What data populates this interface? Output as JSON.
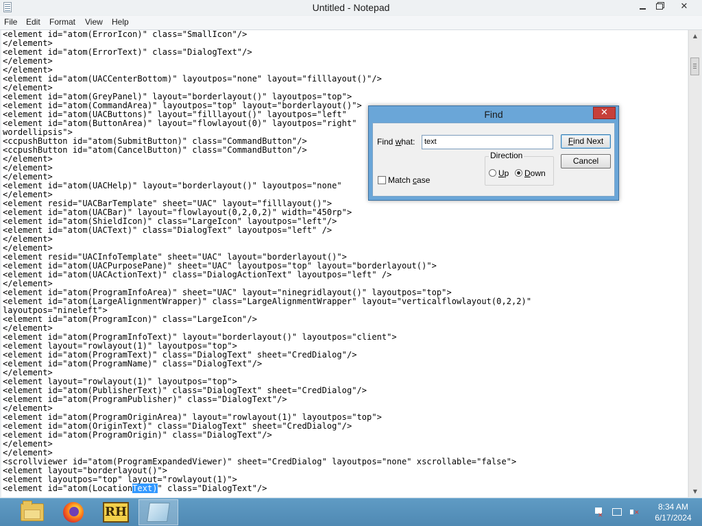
{
  "window": {
    "title": "Untitled - Notepad",
    "minimize_glyph": "",
    "close_glyph": "✕"
  },
  "menu": [
    "File",
    "Edit",
    "Format",
    "View",
    "Help"
  ],
  "editor": {
    "lines_before": [
      "<element id=\"atom(ErrorIcon)\" class=\"SmallIcon\"/>",
      "</element>",
      "<element id=\"atom(ErrorText)\" class=\"DialogText\"/>",
      "</element>",
      "</element>",
      "<element id=\"atom(UACCenterBottom)\" layoutpos=\"none\" layout=\"filllayout()\"/>",
      "</element>",
      "<element id=\"atom(GreyPanel)\" layout=\"borderlayout()\" layoutpos=\"top\">",
      "<element id=\"atom(CommandArea)\" layoutpos=\"top\" layout=\"borderlayout()\">",
      "<element id=\"atom(UACButtons)\" layout=\"filllayout()\" layoutpos=\"left\" ",
      "<element id=\"atom(ButtonArea)\" layout=\"flowlayout(0)\" layoutpos=\"right\" ",
      "wordellipsis\">",
      "<ccpushButton id=\"atom(SubmitButton)\" class=\"CommandButton\"/>",
      "<ccpushButton id=\"atom(CancelButton)\" class=\"CommandButton\"/>",
      "</element>",
      "</element>",
      "</element>",
      "<element id=\"atom(UACHelp)\" layout=\"borderlayout()\" layoutpos=\"none\"",
      "</element>",
      "<element resid=\"UACBarTemplate\" sheet=\"UAC\" layout=\"filllayout()\">",
      "<element id=\"atom(UACBar)\" layout=\"flowlayout(0,2,0,2)\" width=\"450rp\">",
      "<element id=\"atom(ShieldIcon)\" class=\"LargeIcon\" layoutpos=\"left\"/>",
      "<element id=\"atom(UACText)\" class=\"DialogText\" layoutpos=\"left\" />",
      "</element>",
      "</element>",
      "<element resid=\"UACInfoTemplate\" sheet=\"UAC\" layout=\"borderlayout()\">",
      "<element id=\"atom(UACPurposePane)\" sheet=\"UAC\" layoutpos=\"top\" layout=\"borderlayout()\">",
      "<element id=\"atom(UACActionText)\" class=\"DialogActionText\" layoutpos=\"left\" />",
      "</element>",
      "<element id=\"atom(ProgramInfoArea)\" sheet=\"UAC\" layout=\"ninegridlayout()\" layoutpos=\"top\">",
      "<element id=\"atom(LargeAlignmentWrapper)\" class=\"LargeAlignmentWrapper\" layout=\"verticalflowlayout(0,2,2)\"",
      "layoutpos=\"nineleft\">",
      "<element id=\"atom(ProgramIcon)\" class=\"LargeIcon\"/>",
      "</element>",
      "<element id=\"atom(ProgramInfoText)\" layout=\"borderlayout()\" layoutpos=\"client\">",
      "<element layout=\"rowlayout(1)\" layoutpos=\"top\">",
      "<element id=\"atom(ProgramText)\" class=\"DialogText\" sheet=\"CredDialog\"/>",
      "<element id=\"atom(ProgramName)\" class=\"DialogText\"/>",
      "</element>",
      "<element layout=\"rowlayout(1)\" layoutpos=\"top\">",
      "<element id=\"atom(PublisherText)\" class=\"DialogText\" sheet=\"CredDialog\"/>",
      "<element id=\"atom(ProgramPublisher)\" class=\"DialogText\"/>",
      "</element>",
      "<element id=\"atom(ProgramOriginArea)\" layout=\"rowlayout(1)\" layoutpos=\"top\">",
      "<element id=\"atom(OriginText)\" class=\"DialogText\" sheet=\"CredDialog\"/>",
      "<element id=\"atom(ProgramOrigin)\" class=\"DialogText\"/>",
      "</element>",
      "</element>",
      "<scrollviewer id=\"atom(ProgramExpandedViewer)\" sheet=\"CredDialog\" layoutpos=\"none\" xscrollable=\"false\">",
      "<element layout=\"borderlayout()\">",
      "<element layoutpos=\"top\" layout=\"rowlayout(1)\">"
    ],
    "last_line_prefix": "<element id=\"atom(Location",
    "last_line_selected": "Text)",
    "last_line_suffix": "\" class=\"DialogText\"/>"
  },
  "find_dialog": {
    "title": "Find",
    "close_glyph": "✕",
    "find_what_label": "Find what:",
    "find_what_value": "text",
    "find_next_label": "Find Next",
    "cancel_label": "Cancel",
    "direction_label": "Direction",
    "up_label": "Up",
    "down_label": "Down",
    "direction_selected": "Down",
    "match_case_label": "Match case",
    "match_case_checked": false
  },
  "taskbar": {
    "apps": [
      "file-explorer-icon",
      "firefox-icon",
      "robohelp-icon",
      "notepad-icon"
    ],
    "rh_text": "RH",
    "clock_time": "8:34 AM",
    "clock_date": "6/17/2024"
  }
}
